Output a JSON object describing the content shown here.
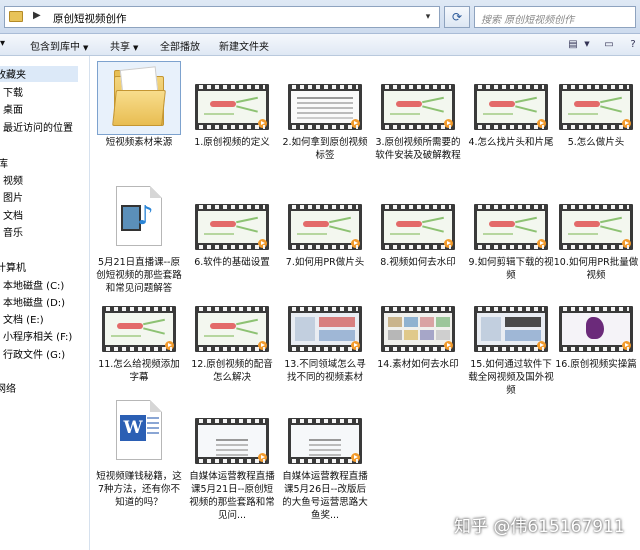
{
  "address_bar": {
    "path": "原创短视频创作",
    "separator": "▶",
    "search_placeholder": "搜索 原创短视频创作"
  },
  "toolbar": {
    "include_label": "包含到库中",
    "share_label": "共享",
    "play_all_label": "全部播放",
    "new_folder_label": "新建文件夹"
  },
  "sidebar": {
    "favorites": "收藏夹",
    "downloads": "下载",
    "desktop": "桌面",
    "recent": "最近访问的位置",
    "libraries": "库",
    "videos": "视频",
    "pictures": "图片",
    "documents": "文档",
    "music": "音乐",
    "computer": "计算机",
    "drive_c": "本地磁盘 (C:)",
    "drive_d": "本地磁盘 (D:)",
    "drive_e": "文档 (E:)",
    "drive_f": "小程序相关 (F:)",
    "drive_g": "行政文件 (G:)",
    "network": "网络"
  },
  "files": [
    {
      "name": "短视频素材来源",
      "icon": "folder-icon"
    },
    {
      "name": "1.原创视频的定义",
      "icon": "video-thumbnail"
    },
    {
      "name": "2.如何拿到原创视频标签",
      "icon": "video-thumbnail"
    },
    {
      "name": "3.原创视频所需要的软件安装及破解教程",
      "icon": "video-thumbnail"
    },
    {
      "name": "4.怎么找片头和片尾",
      "icon": "video-thumbnail"
    },
    {
      "name": "5.怎么做片头",
      "icon": "video-thumbnail"
    },
    {
      "name": "5月21日直播课--原创短视频的那些套路和常见问题解答",
      "icon": "media-file-icon"
    },
    {
      "name": "6.软件的基础设置",
      "icon": "video-thumbnail"
    },
    {
      "name": "7.如何用PR做片头",
      "icon": "video-thumbnail"
    },
    {
      "name": "8.视频如何去水印",
      "icon": "video-thumbnail"
    },
    {
      "name": "9.如何剪辑下载的视频",
      "icon": "video-thumbnail"
    },
    {
      "name": "10.如何用PR批量做视频",
      "icon": "video-thumbnail"
    },
    {
      "name": "11.怎么给视频添加字幕",
      "icon": "video-thumbnail"
    },
    {
      "name": "12.原创视频的配音怎么解决",
      "icon": "video-thumbnail"
    },
    {
      "name": "13.不同领域怎么寻找不同的视频素材",
      "icon": "video-thumbnail"
    },
    {
      "name": "14.素材如何去水印",
      "icon": "video-thumbnail"
    },
    {
      "name": "15.如何通过软件下载全网视频及国外视频",
      "icon": "video-thumbnail"
    },
    {
      "name": "16.原创视频实操篇",
      "icon": "video-thumbnail"
    },
    {
      "name": "短视频赚钱秘籍，这7种方法，还有你不知道的吗？",
      "icon": "word-document-icon"
    },
    {
      "name": "自媒体运营教程直播课5月21日--原创短视频的那些套路和常见问...",
      "icon": "video-thumbnail"
    },
    {
      "name": "自媒体运营教程直播课5月26日--改版后的大鱼号运营思路大鱼奖...",
      "icon": "video-thumbnail"
    }
  ],
  "watermark": "知乎 @伟615167911",
  "colors": {
    "toolbar_bg": "#dfe8f4",
    "selection": "#dce9f8",
    "play_badge": "#f29b2d"
  }
}
